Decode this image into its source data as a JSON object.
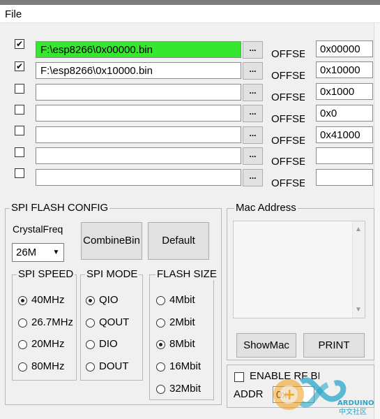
{
  "menu": {
    "file": "File"
  },
  "files": [
    {
      "checked": true,
      "path": "F:\\esp8266\\0x00000.bin",
      "highlight": true,
      "offset_label": "OFFSET",
      "offset": "0x00000"
    },
    {
      "checked": true,
      "path": "F:\\esp8266\\0x10000.bin",
      "highlight": false,
      "offset_label": "OFFSET",
      "offset": "0x10000"
    },
    {
      "checked": false,
      "path": "",
      "highlight": false,
      "offset_label": "OFFSET",
      "offset": "0x1000"
    },
    {
      "checked": false,
      "path": "",
      "highlight": false,
      "offset_label": "OFFSET",
      "offset": "0x0"
    },
    {
      "checked": false,
      "path": "",
      "highlight": false,
      "offset_label": "OFFSET",
      "offset": "0x41000"
    },
    {
      "checked": false,
      "path": "",
      "highlight": false,
      "offset_label": "OFFSET",
      "offset": ""
    },
    {
      "checked": false,
      "path": "",
      "highlight": false,
      "offset_label": "OFFSET",
      "offset": ""
    }
  ],
  "browse_label": "...",
  "spi_config": {
    "title": "SPI FLASH CONFIG",
    "crystal_label": "CrystalFreq",
    "crystal_value": "26M",
    "combine_button": "CombineBin",
    "default_button": "Default",
    "speed": {
      "title": "SPI SPEED",
      "options": [
        "40MHz",
        "26.7MHz",
        "20MHz",
        "80MHz"
      ],
      "selected": 0
    },
    "mode": {
      "title": "SPI MODE",
      "options": [
        "QIO",
        "QOUT",
        "DIO",
        "DOUT"
      ],
      "selected": 0
    },
    "size": {
      "title": "FLASH SIZE",
      "options": [
        "4Mbit",
        "2Mbit",
        "8Mbit",
        "16Mbit",
        "32Mbit"
      ],
      "selected": 2
    }
  },
  "mac": {
    "title": "Mac Address",
    "show_button": "ShowMac",
    "print_button": "PRINT"
  },
  "bottom": {
    "enable_label": "ENABLE RF BIN",
    "addr_label": "ADDR",
    "addr_value": "0x"
  },
  "watermark": {
    "brand": "ARDUINO",
    "sub": "中文社区"
  },
  "colors": {
    "highlight": "#37e62e",
    "window_bg": "#f0f0f0"
  }
}
